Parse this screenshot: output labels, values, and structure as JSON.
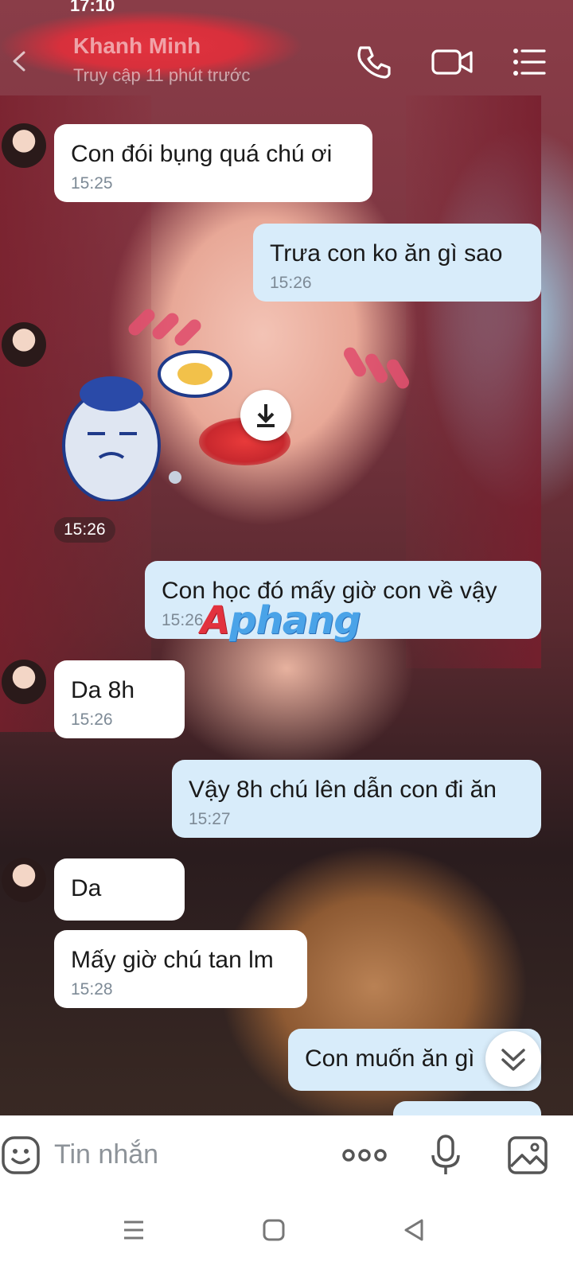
{
  "status_bar": {
    "time": "17:10"
  },
  "header": {
    "contact_name": "Khanh Minh",
    "contact_status": "Truy cập 11 phút trước",
    "icons": [
      "back-icon",
      "phone-icon",
      "video-call-icon",
      "menu-icon"
    ]
  },
  "messages": [
    {
      "direction": "in",
      "text": "Con đói bụng quá chú ơi",
      "time": "15:25",
      "avatar": true
    },
    {
      "direction": "out",
      "text": "Trưa con ko ăn gì sao",
      "time": "15:26"
    },
    {
      "direction": "in",
      "type": "sticker",
      "time": "15:26",
      "avatar": true
    },
    {
      "direction": "out",
      "text": "Con học đó mấy giờ con về vậy",
      "time": "15:26"
    },
    {
      "direction": "in",
      "text": "Da 8h",
      "time": "15:26",
      "avatar": true
    },
    {
      "direction": "out",
      "text": "Vậy 8h chú lên dẫn con đi ăn",
      "time": "15:27"
    },
    {
      "direction": "in",
      "text": "Da",
      "time": "",
      "avatar": true
    },
    {
      "direction": "in",
      "text": "Mấy giờ chú tan lm",
      "time": "15:28"
    },
    {
      "direction": "out",
      "text": "Con muốn ăn gì",
      "time": ""
    }
  ],
  "watermark": {
    "first": "A",
    "rest": "phang"
  },
  "input_bar": {
    "placeholder": "Tin nhắn",
    "icons": [
      "emoji-icon",
      "more-icon",
      "microphone-icon",
      "image-icon"
    ]
  },
  "nav_bar": {
    "icons": [
      "recent-apps-icon",
      "home-icon",
      "back-nav-icon"
    ]
  },
  "colors": {
    "incoming_bubble": "#ffffff",
    "outgoing_bubble": "#d8ecfa",
    "time_text": "#7d8a96"
  }
}
